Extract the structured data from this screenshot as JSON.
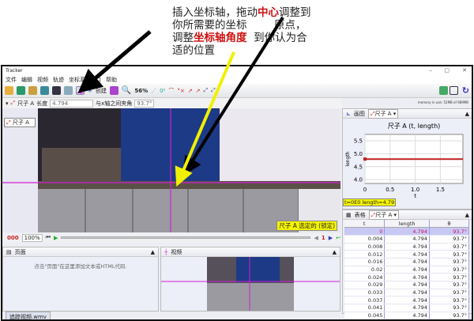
{
  "annotation": {
    "line1a": "插入坐标轴，拖动",
    "line1b": "中心",
    "line1c": "调整到",
    "line2": "你所需要的坐标        原点，",
    "line3a": "调整",
    "line3b": "坐标轴角度",
    "line3c": "  到你认为合",
    "line4": "适的位置"
  },
  "window": {
    "title": "Tracker",
    "controls": [
      "–",
      "▢",
      "✕"
    ]
  },
  "menu": [
    "文件",
    "编辑",
    "视频",
    "轨迹",
    "坐标系",
    "窗口",
    "帮助"
  ],
  "toolbar": {
    "create_label": "创建",
    "zoom_label": "56%"
  },
  "ruler_bar": {
    "track_name": "尺子 A",
    "length_label": "长度",
    "length_value": "4.794",
    "angle_label": "与x轴之间夹角",
    "angle_value": "93.7°"
  },
  "memory": "memory in use: 52MB of 989MB",
  "video": {
    "track_tag": "尺子 A",
    "status_label": "尺子 A 选定的 (锁定)"
  },
  "controls": {
    "frame": "000",
    "zoom": "100%",
    "step": "1"
  },
  "page_panel": {
    "title": "页面",
    "hint": "点击\"页面\"在这里添加文本或HTML代码."
  },
  "video_panel": {
    "title": "视频"
  },
  "plot_panel": {
    "tab": "画图",
    "track": "尺子 A"
  },
  "table_panel": {
    "tab": "表格",
    "track": "尺子 A",
    "columns": [
      "t",
      "length",
      "θ"
    ],
    "rows": [
      [
        "0",
        "4.794",
        "93.7°"
      ],
      [
        "0.004",
        "4.794",
        "93.7°"
      ],
      [
        "0.008",
        "4.794",
        "93.7°"
      ],
      [
        "0.012",
        "4.794",
        "93.7°"
      ],
      [
        "0.016",
        "4.794",
        "93.7°"
      ],
      [
        "0.02",
        "4.794",
        "93.7°"
      ],
      [
        "0.024",
        "4.794",
        "93.7°"
      ],
      [
        "0.029",
        "4.794",
        "93.7°"
      ],
      [
        "0.033",
        "4.794",
        "93.7°"
      ],
      [
        "0.037",
        "4.794",
        "93.7°"
      ],
      [
        "0.041",
        "4.794",
        "93.7°"
      ],
      [
        "0.045",
        "4.794",
        "93.7°"
      ]
    ]
  },
  "chart_data": {
    "type": "line",
    "title": "尺子 A (t, length)",
    "xlabel": "t",
    "ylabel": "length",
    "xlim": [
      0,
      1.95
    ],
    "ylim": [
      3.85,
      5.75
    ],
    "xticks": [
      "0",
      "0.5",
      "1.0",
      "1.5"
    ],
    "yticks": [
      "4.0",
      "4.5",
      "5.0",
      "5.5"
    ],
    "grid": true,
    "series": [
      {
        "x": [
          0,
          1.95
        ],
        "y": [
          4.794,
          4.794
        ],
        "color": "#c02020"
      }
    ],
    "readout": "t=0E0  length=4.79"
  },
  "file_tab": "追踪视频.wmv",
  "colors": {
    "axis": "#d020d0",
    "highlight": "#f4f400",
    "accent_red": "#d01010"
  }
}
